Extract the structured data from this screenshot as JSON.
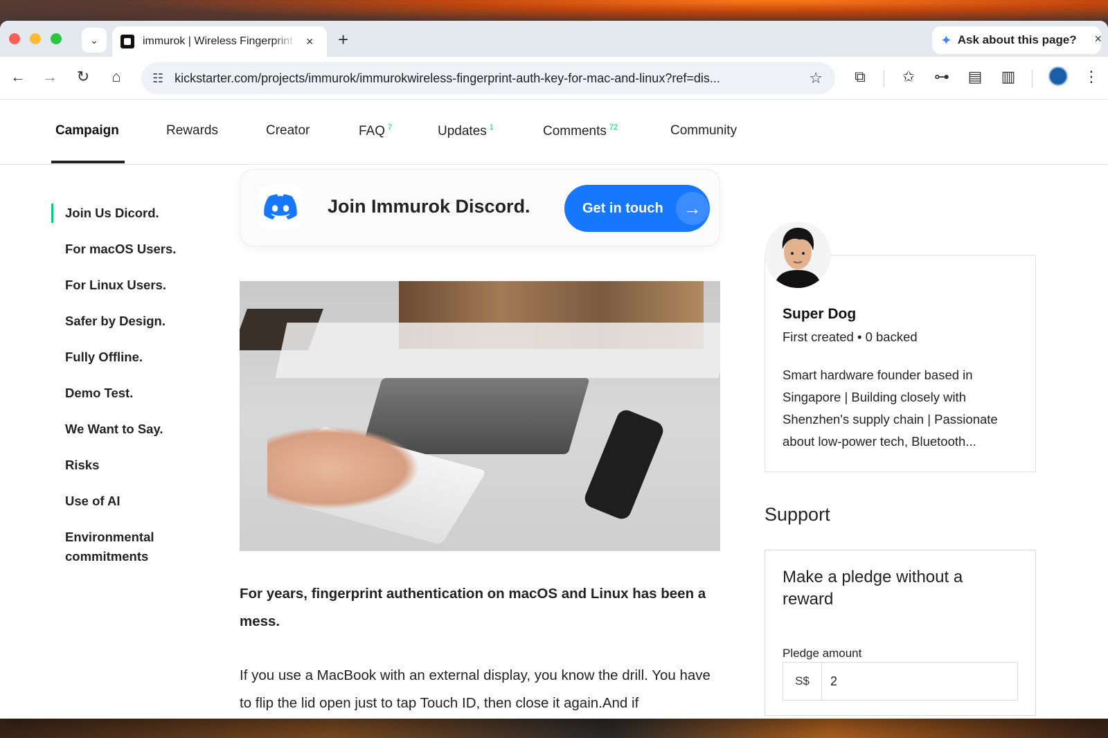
{
  "browser": {
    "tab_title": "immurok | Wireless Fingerprint",
    "tab_close": "×",
    "new_tab": "+",
    "ask_label": "Ask about this page?",
    "ask_close": "×",
    "url": "kickstarter.com/projects/immurok/immurokwireless-fingerprint-auth-key-for-mac-and-linux?ref=dis..."
  },
  "campaign_nav": [
    {
      "label": "Campaign",
      "count": ""
    },
    {
      "label": "Rewards",
      "count": ""
    },
    {
      "label": "Creator",
      "count": ""
    },
    {
      "label": "FAQ",
      "count": "7"
    },
    {
      "label": "Updates",
      "count": "1"
    },
    {
      "label": "Comments",
      "count": "72"
    },
    {
      "label": "Community",
      "count": ""
    }
  ],
  "toc": [
    "Join Us Dicord.",
    "For macOS Users.",
    "For Linux Users.",
    "Safer by Design.",
    "Fully Offline.",
    "Demo Test.",
    "We Want to Say.",
    "Risks",
    "Use of AI",
    "Environmental commitments"
  ],
  "discord": {
    "title": "Join Immurok Discord.",
    "button": "Get in touch",
    "arrow": "→"
  },
  "body": {
    "lead": "For years, fingerprint authentication on macOS and Linux has been a mess.",
    "para": "If you use a MacBook with an external display, you know the drill. You have to flip the lid open just to tap Touch ID, then close it again.And if"
  },
  "creator": {
    "name": "Super Dog",
    "meta": "First created • 0 backed",
    "bio": "Smart hardware founder based in Singapore | Building closely with Shenzhen's supply chain | Passionate about low-power tech, Bluetooth..."
  },
  "support": {
    "heading": "Support",
    "pledge_title": "Make a pledge without a reward",
    "pledge_label": "Pledge amount",
    "currency": "S$",
    "amount": "2"
  },
  "colors": {
    "accent_green": "#05ce78",
    "button_blue": "#1677ff"
  }
}
